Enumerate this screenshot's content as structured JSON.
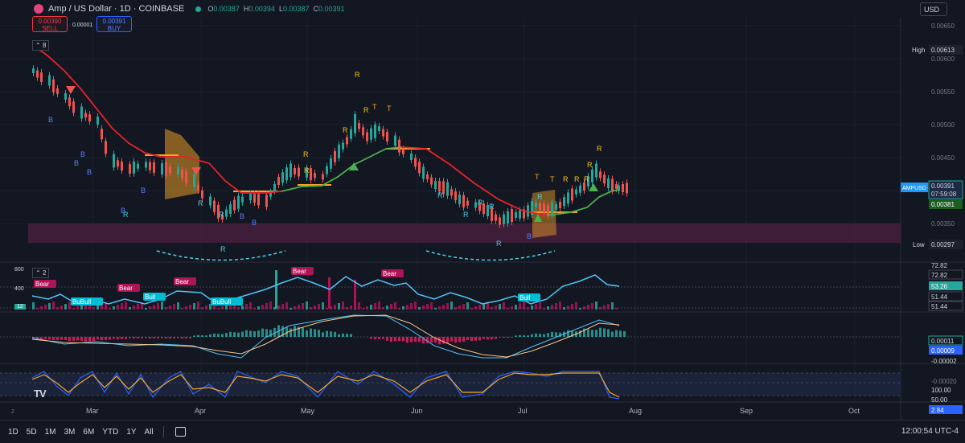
{
  "header": {
    "symbol_title": "Amp / US Dollar · 1D · COINBASE",
    "ohlc": [
      {
        "k": "O",
        "v": "0.00387"
      },
      {
        "k": "H",
        "v": "0.00394"
      },
      {
        "k": "L",
        "v": "0.00387"
      },
      {
        "k": "C",
        "v": "0.00391"
      }
    ],
    "sell_price": "0.00390",
    "sell_label": "SELL",
    "buy_price": "0.00391",
    "buy_label": "BUY",
    "spread": "0.00001",
    "currency": "USD",
    "indicator_count_main": "8",
    "indicator_count_pane2": "2"
  },
  "price_axis": {
    "ticks": [
      "0.00650",
      "0.00600",
      "0.00550",
      "0.00500",
      "0.00450",
      "0.00400",
      "0.00350"
    ],
    "high_label": "High",
    "high_value": "0.00613",
    "low_label": "Low",
    "low_value": "0.00297",
    "symbol_tag": "AMPUSD",
    "last_price": "0.00391",
    "countdown": "07:59:08",
    "ma_value": "0.00381",
    "colors": {
      "up": "#26a69a",
      "down": "#ef5350",
      "ma_red": "#e8212b",
      "ma_green": "#4caf50",
      "zone": "#4a1f3e",
      "orange": "#f5a623"
    }
  },
  "time_axis": {
    "labels": [
      "Mar",
      "Apr",
      "May",
      "Jun",
      "Jul",
      "Aug",
      "Sep",
      "Oct"
    ]
  },
  "pane2": {
    "axis": [
      "800",
      "400",
      "12"
    ],
    "values": [
      "72.82",
      "72.82",
      "53.26",
      "51.44",
      "51.44"
    ],
    "tags": [
      "Bear",
      "BuBull",
      "Bear",
      "Bull",
      "Bear",
      "BuBull",
      "Bear",
      "Bear",
      "Bull"
    ]
  },
  "pane3": {
    "values": [
      "0.00011",
      "0.00009",
      "-0.00002",
      "-0.00020"
    ]
  },
  "pane4": {
    "values": [
      "100.00",
      "50.00",
      "2.84"
    ]
  },
  "signals": {
    "labels": [
      "B",
      "B",
      "B",
      "B",
      "B",
      "B",
      "B",
      "B",
      "B",
      "R",
      "R",
      "R",
      "R",
      "R",
      "R",
      "R",
      "R",
      "R",
      "R",
      "R",
      "R",
      "R",
      "R",
      "R",
      "R",
      "R",
      "T",
      "T",
      "T",
      "T",
      "R",
      "R",
      "R"
    ]
  },
  "bottom_bar": {
    "timeframes": [
      "1D",
      "5D",
      "1M",
      "3M",
      "6M",
      "YTD",
      "1Y",
      "All"
    ],
    "clock": "12:00:54 UTC-4",
    "pane_index": "2"
  }
}
